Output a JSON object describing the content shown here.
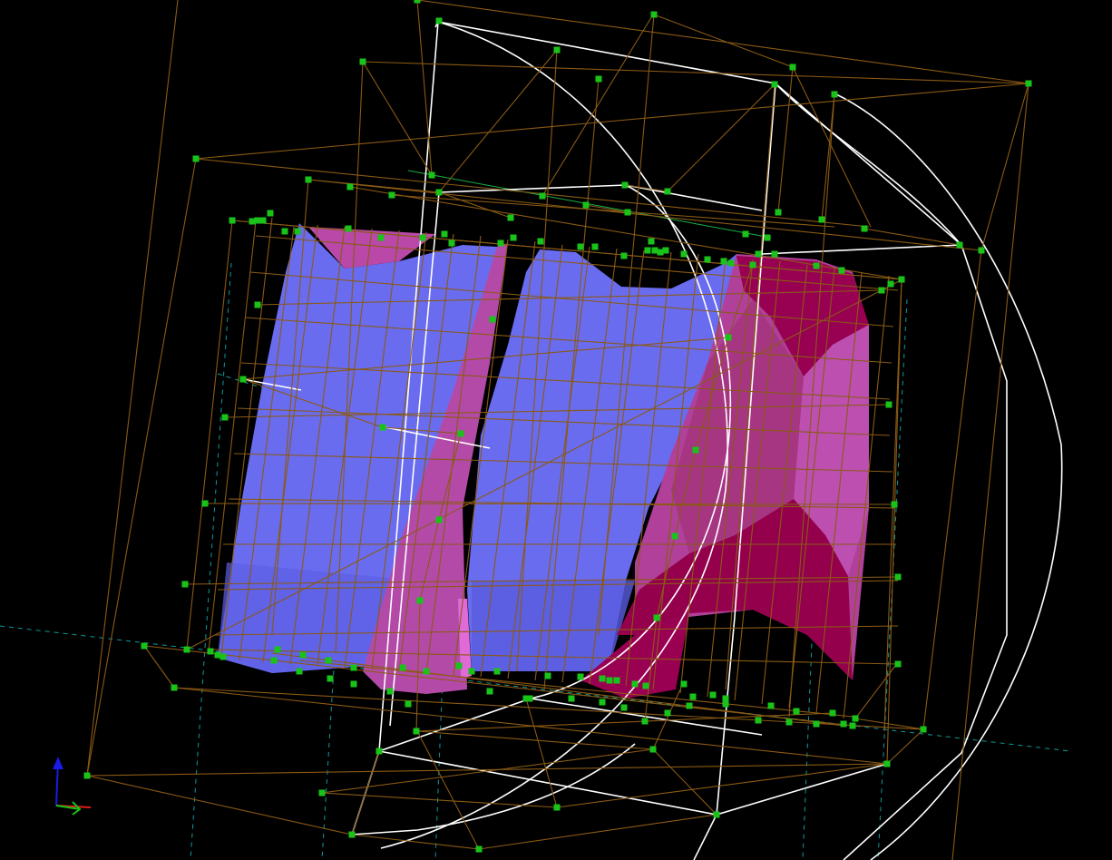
{
  "viewport": {
    "name": "3d-lattice-viewport",
    "background": "#000000"
  },
  "colors": {
    "lattice_edge": "#8a5a14",
    "control_point": "#19c319",
    "mesh_blue": "#6a6cf0",
    "mesh_blue_dark": "#5657d8",
    "mesh_magenta": "#c0409c",
    "mesh_crimson": "#96004e",
    "mesh_pink_light": "#d85ccc",
    "outline_white": "#ffffff",
    "guide_cyan": "#0f9a9a",
    "guide_green": "#17b04a",
    "axis_x": "#e21b1b",
    "axis_y": "#17c117",
    "axis_z": "#1a1ae6"
  },
  "axes_gizmo": {
    "icon": "xyz-axes-icon",
    "axes": [
      "x",
      "y",
      "z"
    ]
  }
}
